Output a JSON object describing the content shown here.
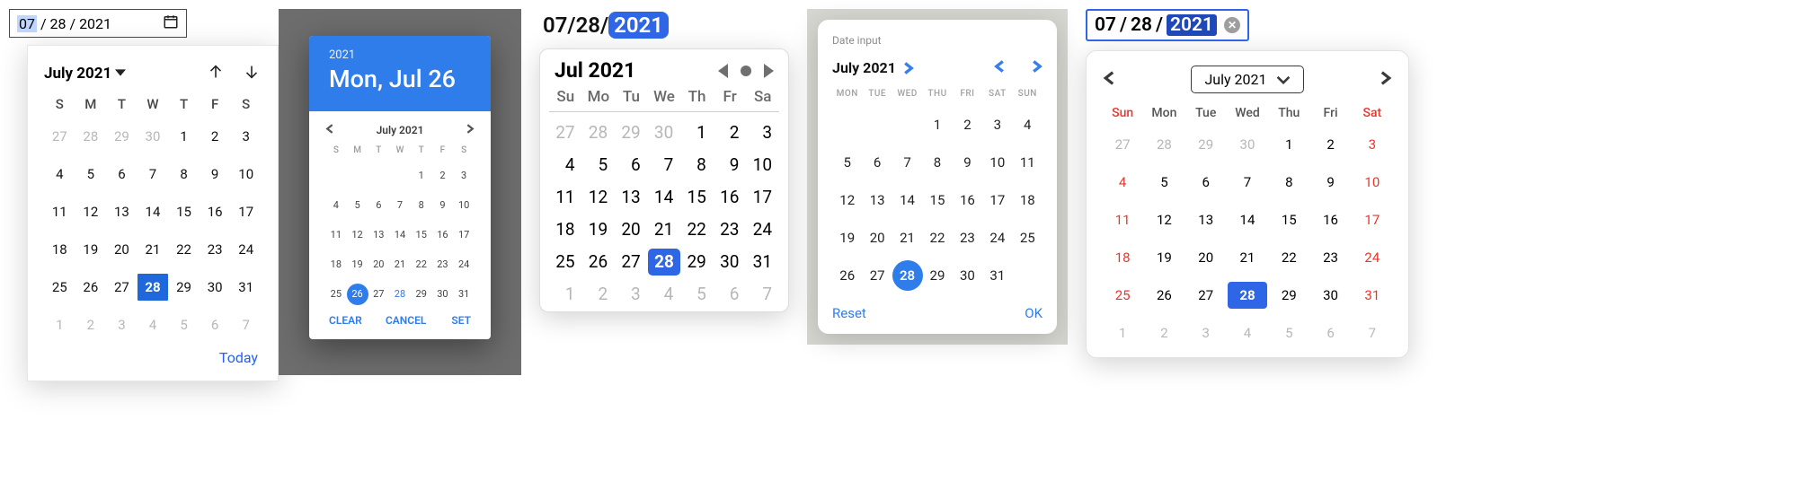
{
  "panel1": {
    "input": {
      "month": "07",
      "sep": " / ",
      "day": "28",
      "year": "2021"
    },
    "title": "July 2021",
    "today_label": "Today",
    "weekdays": [
      "S",
      "M",
      "T",
      "W",
      "T",
      "F",
      "S"
    ],
    "weeks": [
      [
        {
          "n": "27",
          "f": true
        },
        {
          "n": "28",
          "f": true
        },
        {
          "n": "29",
          "f": true
        },
        {
          "n": "30",
          "f": true
        },
        {
          "n": "1"
        },
        {
          "n": "2"
        },
        {
          "n": "3"
        }
      ],
      [
        {
          "n": "4"
        },
        {
          "n": "5"
        },
        {
          "n": "6"
        },
        {
          "n": "7"
        },
        {
          "n": "8"
        },
        {
          "n": "9"
        },
        {
          "n": "10"
        }
      ],
      [
        {
          "n": "11"
        },
        {
          "n": "12"
        },
        {
          "n": "13"
        },
        {
          "n": "14"
        },
        {
          "n": "15"
        },
        {
          "n": "16"
        },
        {
          "n": "17"
        }
      ],
      [
        {
          "n": "18"
        },
        {
          "n": "19"
        },
        {
          "n": "20"
        },
        {
          "n": "21"
        },
        {
          "n": "22"
        },
        {
          "n": "23"
        },
        {
          "n": "24"
        }
      ],
      [
        {
          "n": "25"
        },
        {
          "n": "26"
        },
        {
          "n": "27"
        },
        {
          "n": "28",
          "sel": true
        },
        {
          "n": "29"
        },
        {
          "n": "30"
        },
        {
          "n": "31"
        }
      ],
      [
        {
          "n": "1",
          "f": true
        },
        {
          "n": "2",
          "f": true
        },
        {
          "n": "3",
          "f": true
        },
        {
          "n": "4",
          "f": true
        },
        {
          "n": "5",
          "f": true
        },
        {
          "n": "6",
          "f": true
        },
        {
          "n": "7",
          "f": true
        }
      ]
    ]
  },
  "panel2": {
    "banner": {
      "year": "2021",
      "date": "Mon, Jul 26"
    },
    "month_title": "July 2021",
    "actions": {
      "clear": "CLEAR",
      "cancel": "CANCEL",
      "set": "SET"
    },
    "weekdays": [
      "S",
      "M",
      "T",
      "W",
      "T",
      "F",
      "S"
    ],
    "weeks": [
      [
        {
          "n": ""
        },
        {
          "n": ""
        },
        {
          "n": ""
        },
        {
          "n": ""
        },
        {
          "n": "1"
        },
        {
          "n": "2"
        },
        {
          "n": "3"
        }
      ],
      [
        {
          "n": "4"
        },
        {
          "n": "5"
        },
        {
          "n": "6"
        },
        {
          "n": "7"
        },
        {
          "n": "8"
        },
        {
          "n": "9"
        },
        {
          "n": "10"
        }
      ],
      [
        {
          "n": "11"
        },
        {
          "n": "12"
        },
        {
          "n": "13"
        },
        {
          "n": "14"
        },
        {
          "n": "15"
        },
        {
          "n": "16"
        },
        {
          "n": "17"
        }
      ],
      [
        {
          "n": "18"
        },
        {
          "n": "19"
        },
        {
          "n": "20"
        },
        {
          "n": "21"
        },
        {
          "n": "22"
        },
        {
          "n": "23"
        },
        {
          "n": "24"
        }
      ],
      [
        {
          "n": "25"
        },
        {
          "n": "26",
          "sel": true
        },
        {
          "n": "27"
        },
        {
          "n": "28",
          "alt": true
        },
        {
          "n": "29"
        },
        {
          "n": "30"
        },
        {
          "n": "31"
        }
      ]
    ]
  },
  "panel3": {
    "input": {
      "month": "07",
      "day": "28",
      "year": "2021"
    },
    "title": "Jul 2021",
    "weekdays": [
      "Su",
      "Mo",
      "Tu",
      "We",
      "Th",
      "Fr",
      "Sa"
    ],
    "weeks": [
      [
        {
          "n": "27",
          "f": true
        },
        {
          "n": "28",
          "f": true
        },
        {
          "n": "29",
          "f": true
        },
        {
          "n": "30",
          "f": true
        },
        {
          "n": "1"
        },
        {
          "n": "2"
        },
        {
          "n": "3"
        }
      ],
      [
        {
          "n": "4"
        },
        {
          "n": "5"
        },
        {
          "n": "6"
        },
        {
          "n": "7"
        },
        {
          "n": "8"
        },
        {
          "n": "9"
        },
        {
          "n": "10"
        }
      ],
      [
        {
          "n": "11"
        },
        {
          "n": "12"
        },
        {
          "n": "13"
        },
        {
          "n": "14"
        },
        {
          "n": "15"
        },
        {
          "n": "16"
        },
        {
          "n": "17"
        }
      ],
      [
        {
          "n": "18"
        },
        {
          "n": "19"
        },
        {
          "n": "20"
        },
        {
          "n": "21"
        },
        {
          "n": "22"
        },
        {
          "n": "23"
        },
        {
          "n": "24"
        }
      ],
      [
        {
          "n": "25"
        },
        {
          "n": "26"
        },
        {
          "n": "27"
        },
        {
          "n": "28",
          "sel": true
        },
        {
          "n": "29"
        },
        {
          "n": "30"
        },
        {
          "n": "31"
        }
      ],
      [
        {
          "n": "1",
          "f": true
        },
        {
          "n": "2",
          "f": true
        },
        {
          "n": "3",
          "f": true
        },
        {
          "n": "4",
          "f": true
        },
        {
          "n": "5",
          "f": true
        },
        {
          "n": "6",
          "f": true
        },
        {
          "n": "7",
          "f": true
        }
      ]
    ]
  },
  "panel4": {
    "label": "Date input",
    "title": "July 2021",
    "actions": {
      "reset": "Reset",
      "ok": "OK"
    },
    "weekdays": [
      "MON",
      "TUE",
      "WED",
      "THU",
      "FRI",
      "SAT",
      "SUN"
    ],
    "weeks": [
      [
        {
          "n": ""
        },
        {
          "n": ""
        },
        {
          "n": ""
        },
        {
          "n": "1"
        },
        {
          "n": "2"
        },
        {
          "n": "3"
        },
        {
          "n": "4"
        }
      ],
      [
        {
          "n": "5"
        },
        {
          "n": "6"
        },
        {
          "n": "7"
        },
        {
          "n": "8"
        },
        {
          "n": "9"
        },
        {
          "n": "10"
        },
        {
          "n": "11"
        }
      ],
      [
        {
          "n": "12"
        },
        {
          "n": "13"
        },
        {
          "n": "14"
        },
        {
          "n": "15"
        },
        {
          "n": "16"
        },
        {
          "n": "17"
        },
        {
          "n": "18"
        }
      ],
      [
        {
          "n": "19"
        },
        {
          "n": "20"
        },
        {
          "n": "21"
        },
        {
          "n": "22"
        },
        {
          "n": "23"
        },
        {
          "n": "24"
        },
        {
          "n": "25"
        }
      ],
      [
        {
          "n": "26"
        },
        {
          "n": "27"
        },
        {
          "n": "28",
          "sel": true
        },
        {
          "n": "29"
        },
        {
          "n": "30"
        },
        {
          "n": "31"
        },
        {
          "n": ""
        }
      ]
    ]
  },
  "panel5": {
    "input": {
      "month": "07",
      "day": "28",
      "year": "2021"
    },
    "month_selector": "July 2021",
    "weekdays": [
      {
        "t": "Sun",
        "we": true
      },
      {
        "t": "Mon"
      },
      {
        "t": "Tue"
      },
      {
        "t": "Wed"
      },
      {
        "t": "Thu"
      },
      {
        "t": "Fri"
      },
      {
        "t": "Sat",
        "we": true
      }
    ],
    "weeks": [
      [
        {
          "n": "27",
          "we": true,
          "f": true
        },
        {
          "n": "28",
          "f": true
        },
        {
          "n": "29",
          "f": true
        },
        {
          "n": "30",
          "f": true
        },
        {
          "n": "1"
        },
        {
          "n": "2"
        },
        {
          "n": "3",
          "we": true
        }
      ],
      [
        {
          "n": "4",
          "we": true
        },
        {
          "n": "5"
        },
        {
          "n": "6"
        },
        {
          "n": "7"
        },
        {
          "n": "8"
        },
        {
          "n": "9"
        },
        {
          "n": "10",
          "we": true
        }
      ],
      [
        {
          "n": "11",
          "we": true
        },
        {
          "n": "12"
        },
        {
          "n": "13"
        },
        {
          "n": "14"
        },
        {
          "n": "15"
        },
        {
          "n": "16"
        },
        {
          "n": "17",
          "we": true
        }
      ],
      [
        {
          "n": "18",
          "we": true
        },
        {
          "n": "19"
        },
        {
          "n": "20"
        },
        {
          "n": "21"
        },
        {
          "n": "22"
        },
        {
          "n": "23"
        },
        {
          "n": "24",
          "we": true
        }
      ],
      [
        {
          "n": "25",
          "we": true
        },
        {
          "n": "26"
        },
        {
          "n": "27"
        },
        {
          "n": "28",
          "sel": true
        },
        {
          "n": "29"
        },
        {
          "n": "30"
        },
        {
          "n": "31",
          "we": true
        }
      ],
      [
        {
          "n": "1",
          "we": true,
          "f": true
        },
        {
          "n": "2",
          "f": true
        },
        {
          "n": "3",
          "f": true
        },
        {
          "n": "4",
          "f": true
        },
        {
          "n": "5",
          "f": true
        },
        {
          "n": "6",
          "f": true
        },
        {
          "n": "7",
          "we": true,
          "f": true
        }
      ]
    ]
  }
}
